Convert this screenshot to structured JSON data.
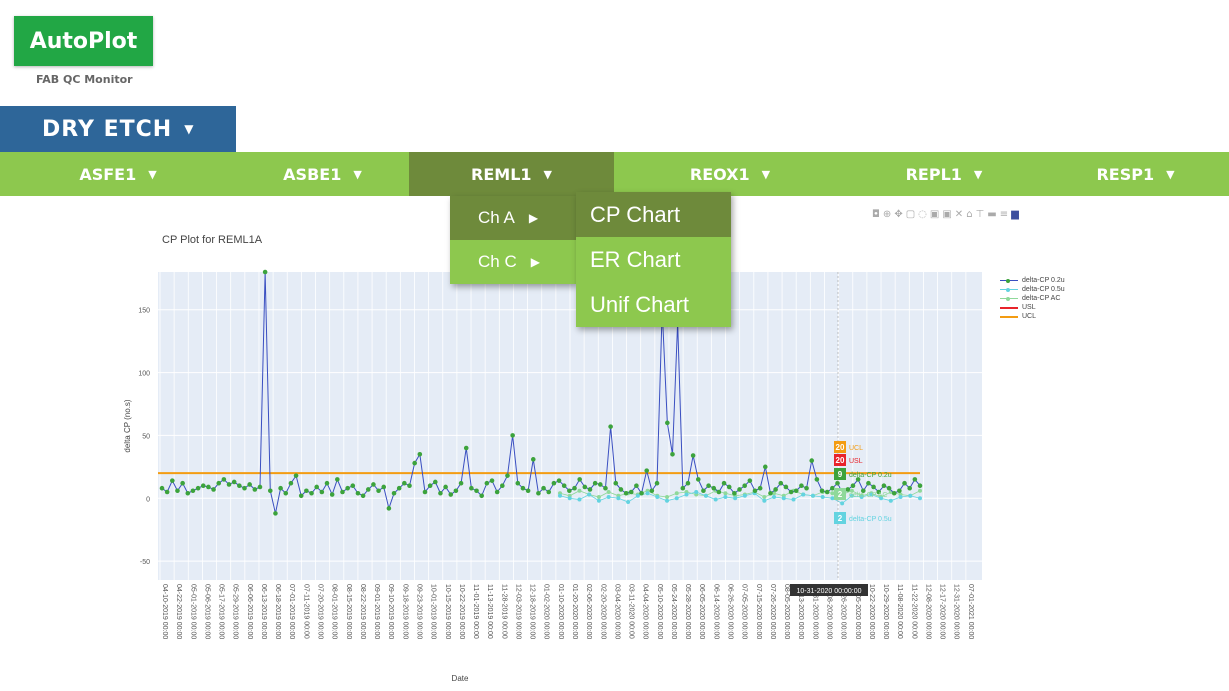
{
  "brand": {
    "name": "AutoPlot",
    "subtitle": "FAB QC Monitor"
  },
  "area": {
    "label": "DRY ETCH"
  },
  "tools": [
    {
      "label": "ASFE1"
    },
    {
      "label": "ASBE1"
    },
    {
      "label": "REML1"
    },
    {
      "label": "REOX1"
    },
    {
      "label": "REPL1"
    },
    {
      "label": "RESP1"
    }
  ],
  "submenu": [
    {
      "label": "Ch A"
    },
    {
      "label": "Ch C"
    }
  ],
  "chart_menu": [
    {
      "label": "CP Chart"
    },
    {
      "label": "ER Chart"
    },
    {
      "label": "Unif Chart"
    }
  ],
  "colors": {
    "accent": "#8dc84e",
    "accent_dark": "#6e8a3b",
    "area": "#2e6699",
    "logo": "#22a745"
  },
  "chart_data": {
    "type": "line",
    "title": "CP Plot for REML1A",
    "xlabel": "Date",
    "ylabel": "delta CP (no.s)",
    "ylim": [
      -65,
      180
    ],
    "yticks": [
      -50,
      0,
      50,
      100,
      150
    ],
    "grid": true,
    "legend_position": "right",
    "x_ticks": [
      "04-10-2019 00:00",
      "04-22-2019 00:00",
      "05-01-2019 00:00",
      "05-06-2019 00:00",
      "05-17-2019 00:00",
      "05-29-2019 00:00",
      "06-06-2019 00:00",
      "06-13-2019 00:00",
      "06-18-2019 00:00",
      "07-01-2019 00:00",
      "07-11-2019 00:00",
      "07-20-2019 00:00",
      "08-01-2019 00:00",
      "08-15-2019 00:00",
      "08-22-2019 00:00",
      "09-01-2019 00:00",
      "09-10-2019 00:00",
      "09-18-2019 00:00",
      "09-23-2019 00:00",
      "10-01-2019 00:00",
      "10-15-2019 00:00",
      "10-22-2019 00:00",
      "11-01-2019 00:00",
      "11-13-2019 00:00",
      "11-28-2019 00:00",
      "12-03-2019 00:00",
      "12-18-2019 00:00",
      "01-02-2020 00:00",
      "01-10-2020 00:00",
      "01-20-2020 00:00",
      "02-06-2020 00:00",
      "02-20-2020 00:00",
      "03-04-2020 00:00",
      "03-11-2020 00:00",
      "04-04-2020 00:00",
      "05-10-2020 00:00",
      "05-24-2020 00:00",
      "05-28-2020 00:00",
      "06-05-2020 00:00",
      "06-14-2020 00:00",
      "06-26-2020 00:00",
      "07-05-2020 00:00",
      "07-15-2020 00:00",
      "07-26-2020 00:00",
      "08-05-2020 00:00",
      "08-13-2020 00:00",
      "08-31-2020 00:00",
      "09-08-2020 00:00",
      "09-26-2020 00:00",
      "10-05-2020 00:00",
      "10-22-2020 00:00",
      "10-29-2020 00:00",
      "11-08-2020 00:00",
      "11-22-2020 00:00",
      "12-08-2020 00:00",
      "12-17-2020 00:00",
      "12-31-2020 00:00",
      "07-01-2021 00:00"
    ],
    "series": [
      {
        "name": "delta-CP 0.2u",
        "color": "#3a4fc1",
        "marker": "#3ca33c",
        "values": [
          8,
          5,
          14,
          6,
          12,
          4,
          6,
          8,
          10,
          9,
          7,
          12,
          15,
          11,
          13,
          10,
          8,
          11,
          7,
          9,
          180,
          6,
          -12,
          8,
          4,
          12,
          18,
          2,
          6,
          4,
          9,
          5,
          12,
          3,
          15,
          5,
          8,
          10,
          4,
          2,
          7,
          11,
          6,
          9,
          -8,
          4,
          8,
          12,
          10,
          28,
          35,
          5,
          10,
          13,
          4,
          9,
          3,
          6,
          12,
          40,
          8,
          6,
          2,
          12,
          14,
          5,
          10,
          18,
          50,
          12,
          8,
          6,
          31,
          4,
          8,
          5,
          12,
          14,
          10,
          6,
          8,
          15,
          9,
          7,
          12,
          11,
          8,
          57,
          12,
          7,
          4,
          5,
          10,
          4,
          22,
          6,
          12,
          150,
          60,
          35,
          140,
          8,
          12,
          34,
          15,
          6,
          10,
          8,
          5,
          12,
          9,
          4,
          7,
          10,
          14,
          6,
          8,
          25,
          4,
          7,
          12,
          9,
          5,
          6,
          10,
          8,
          30,
          15,
          6,
          5,
          8,
          12,
          4,
          7,
          10,
          15,
          6,
          12,
          9,
          5,
          10,
          8,
          4,
          6,
          12,
          8,
          15,
          10
        ]
      },
      {
        "name": "delta-CP 0.5u",
        "color": "#63d3e0",
        "marker": "#63d3e0",
        "values": [
          2,
          0,
          -1,
          3,
          -2,
          1,
          0,
          -3,
          2,
          4,
          1,
          -2,
          0,
          3,
          5,
          2,
          -1,
          1,
          0,
          2,
          4,
          -2,
          1,
          0,
          -1,
          3,
          2,
          1,
          0,
          -4,
          2,
          1,
          3,
          0,
          -2,
          1,
          2,
          0
        ]
      },
      {
        "name": "delta-CP AC",
        "color": "#8fd99a",
        "marker": "#8fd99a",
        "values": [
          4,
          2,
          6,
          3,
          1,
          5,
          2,
          4,
          3,
          6,
          2,
          1,
          4,
          5,
          3,
          2,
          6,
          4,
          2,
          3,
          5,
          1,
          4,
          2,
          6,
          3,
          2,
          5,
          4,
          3,
          6,
          2,
          4,
          1,
          5,
          3,
          2,
          6
        ]
      },
      {
        "name": "USL",
        "color": "#e8242b",
        "values": []
      },
      {
        "name": "UCL",
        "color": "#f39c12",
        "values": [
          20
        ]
      }
    ],
    "hover": {
      "x_label": "10-31-2020 00:00:00",
      "items": [
        {
          "value": "20",
          "label": "UCL",
          "color": "#f39c12"
        },
        {
          "value": "20",
          "label": "USL",
          "color": "#e8242b"
        },
        {
          "value": "9",
          "label": "delta-CP 0.2u",
          "color": "#3ca33c"
        },
        {
          "value": "2",
          "label": "delta-CP AC",
          "color": "#8fd99a"
        },
        {
          "value": "2",
          "label": "delta-CP 0.5u",
          "color": "#63d3e0"
        }
      ]
    }
  }
}
